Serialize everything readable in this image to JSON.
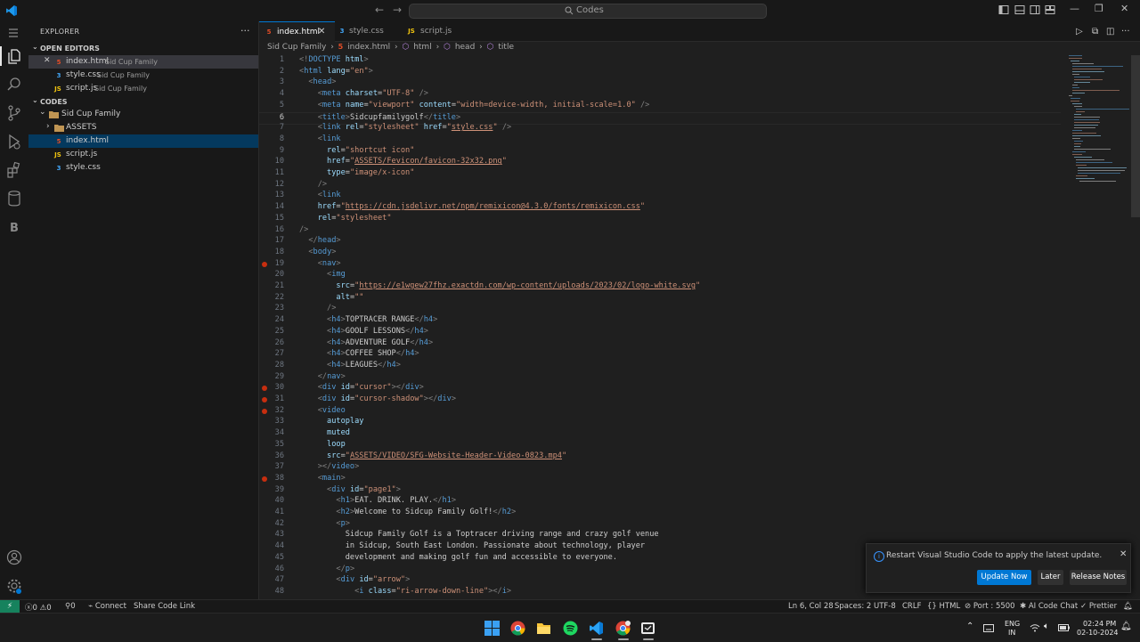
{
  "titlebar": {
    "search_text": "Codes",
    "back_icon": "arrow-left-icon",
    "forward_icon": "arrow-right-icon"
  },
  "activity_bar": {
    "items": [
      "explorer-icon",
      "search-icon",
      "source-control-icon",
      "run-debug-icon",
      "extensions-icon",
      "database-icon",
      "b-icon"
    ],
    "bottom": [
      "account-icon",
      "settings-icon"
    ]
  },
  "sidebar": {
    "title": "EXPLORER",
    "open_editors_label": "OPEN EDITORS",
    "open_editors": [
      {
        "name": "index.html",
        "desc": "Sid Cup Family",
        "type": "html",
        "close": "✕"
      },
      {
        "name": "style.css",
        "desc": "Sid Cup Family",
        "type": "css"
      },
      {
        "name": "script.js",
        "desc": "Sid Cup Family",
        "type": "js"
      }
    ],
    "folder_label": "CODES",
    "tree": {
      "root": "Sid Cup Family",
      "items": [
        {
          "name": "ASSETS",
          "type": "folder"
        },
        {
          "name": "index.html",
          "type": "html"
        },
        {
          "name": "script.js",
          "type": "js"
        },
        {
          "name": "style.css",
          "type": "css"
        }
      ]
    }
  },
  "tabs": [
    {
      "name": "index.html",
      "type": "html",
      "active": true
    },
    {
      "name": "style.css",
      "type": "css",
      "active": false
    },
    {
      "name": "script.js",
      "type": "js",
      "active": false
    }
  ],
  "breadcrumb": [
    "Sid Cup Family",
    "index.html",
    "html",
    "head",
    "title"
  ],
  "code_lines": [
    {
      "n": 1,
      "html": "<span class='t-br'>&lt;!</span><span class='t-tag'>DOCTYPE</span> <span class='t-at'>html</span><span class='t-br'>&gt;</span>"
    },
    {
      "n": 2,
      "html": "<span class='t-br'>&lt;</span><span class='t-tag'>html</span> <span class='t-at'>lang</span><span class='t-tx'>=</span><span class='t-st'>\"en\"</span><span class='t-br'>&gt;</span>"
    },
    {
      "n": 3,
      "html": "  <span class='t-br'>&lt;</span><span class='t-tag'>head</span><span class='t-br'>&gt;</span>"
    },
    {
      "n": 4,
      "html": "    <span class='t-br'>&lt;</span><span class='t-tag'>meta</span> <span class='t-at'>charset</span><span class='t-tx'>=</span><span class='t-st'>\"UTF-8\"</span> <span class='t-br'>/&gt;</span>"
    },
    {
      "n": 5,
      "html": "    <span class='t-br'>&lt;</span><span class='t-tag'>meta</span> <span class='t-at'>name</span><span class='t-tx'>=</span><span class='t-st'>\"viewport\"</span> <span class='t-at'>content</span><span class='t-tx'>=</span><span class='t-st'>\"width=device-width, initial-scale=1.0\"</span> <span class='t-br'>/&gt;</span>"
    },
    {
      "n": 6,
      "html": "    <span class='t-br'>&lt;</span><span class='t-tag'>title</span><span class='t-br'>&gt;</span><span class='t-tx'>Sidcupfamilygolf</span><span class='t-br'>&lt;/</span><span class='t-tag'>title</span><span class='t-br'>&gt;</span>",
      "current": true
    },
    {
      "n": 7,
      "html": "    <span class='t-br'>&lt;</span><span class='t-tag'>link</span> <span class='t-at'>rel</span><span class='t-tx'>=</span><span class='t-st'>\"stylesheet\"</span> <span class='t-at'>href</span><span class='t-tx'>=</span><span class='t-st'>\"</span><span class='t-url'>style.css</span><span class='t-st'>\"</span> <span class='t-br'>/&gt;</span>"
    },
    {
      "n": 8,
      "html": "    <span class='t-br'>&lt;</span><span class='t-tag'>link</span>"
    },
    {
      "n": 9,
      "html": "      <span class='t-at'>rel</span><span class='t-tx'>=</span><span class='t-st'>\"shortcut icon\"</span>"
    },
    {
      "n": 10,
      "html": "      <span class='t-at'>href</span><span class='t-tx'>=</span><span class='t-st'>\"</span><span class='t-url'>ASSETS/Fevicon/favicon-32x32.png</span><span class='t-st'>\"</span>"
    },
    {
      "n": 11,
      "html": "      <span class='t-at'>type</span><span class='t-tx'>=</span><span class='t-st'>\"image/x-icon\"</span>"
    },
    {
      "n": 12,
      "html": "    <span class='t-br'>/&gt;</span>"
    },
    {
      "n": 13,
      "html": "    <span class='t-br'>&lt;</span><span class='t-tag'>link</span>"
    },
    {
      "n": 14,
      "html": "    <span class='t-at'>href</span><span class='t-tx'>=</span><span class='t-st'>\"</span><span class='t-url'>https://cdn.jsdelivr.net/npm/remixicon@4.3.0/fonts/remixicon.css</span><span class='t-st'>\"</span>"
    },
    {
      "n": 15,
      "html": "    <span class='t-at'>rel</span><span class='t-tx'>=</span><span class='t-st'>\"stylesheet\"</span>"
    },
    {
      "n": 16,
      "html": "<span class='t-br'>/&gt;</span>"
    },
    {
      "n": 17,
      "html": "  <span class='t-br'>&lt;/</span><span class='t-tag'>head</span><span class='t-br'>&gt;</span>"
    },
    {
      "n": 18,
      "html": "  <span class='t-br'>&lt;</span><span class='t-tag'>body</span><span class='t-br'>&gt;</span>"
    },
    {
      "n": 19,
      "html": "    <span class='t-br'>&lt;</span><span class='t-tag'>nav</span><span class='t-br'>&gt;</span>",
      "bp": true
    },
    {
      "n": 20,
      "html": "      <span class='t-br'>&lt;</span><span class='t-tag'>img</span>"
    },
    {
      "n": 21,
      "html": "        <span class='t-at'>src</span><span class='t-tx'>=</span><span class='t-st'>\"</span><span class='t-url'>https://e1wgew27fhz.exactdn.com/wp-content/uploads/2023/02/logo-white.svg</span><span class='t-st'>\"</span>"
    },
    {
      "n": 22,
      "html": "        <span class='t-at'>alt</span><span class='t-tx'>=</span><span class='t-st'>\"\"</span>"
    },
    {
      "n": 23,
      "html": "      <span class='t-br'>/&gt;</span>"
    },
    {
      "n": 24,
      "html": "      <span class='t-br'>&lt;</span><span class='t-tag'>h4</span><span class='t-br'>&gt;</span><span class='t-tx'>TOPTRACER RANGE</span><span class='t-br'>&lt;/</span><span class='t-tag'>h4</span><span class='t-br'>&gt;</span>"
    },
    {
      "n": 25,
      "html": "      <span class='t-br'>&lt;</span><span class='t-tag'>h4</span><span class='t-br'>&gt;</span><span class='t-tx'>GOOLF LESSONS</span><span class='t-br'>&lt;/</span><span class='t-tag'>h4</span><span class='t-br'>&gt;</span>"
    },
    {
      "n": 26,
      "html": "      <span class='t-br'>&lt;</span><span class='t-tag'>h4</span><span class='t-br'>&gt;</span><span class='t-tx'>ADVENTURE GOLF</span><span class='t-br'>&lt;/</span><span class='t-tag'>h4</span><span class='t-br'>&gt;</span>"
    },
    {
      "n": 27,
      "html": "      <span class='t-br'>&lt;</span><span class='t-tag'>h4</span><span class='t-br'>&gt;</span><span class='t-tx'>COFFEE SHOP</span><span class='t-br'>&lt;/</span><span class='t-tag'>h4</span><span class='t-br'>&gt;</span>"
    },
    {
      "n": 28,
      "html": "      <span class='t-br'>&lt;</span><span class='t-tag'>h4</span><span class='t-br'>&gt;</span><span class='t-tx'>LEAGUES</span><span class='t-br'>&lt;/</span><span class='t-tag'>h4</span><span class='t-br'>&gt;</span>"
    },
    {
      "n": 29,
      "html": "    <span class='t-br'>&lt;/</span><span class='t-tag'>nav</span><span class='t-br'>&gt;</span>"
    },
    {
      "n": 30,
      "html": "    <span class='t-br'>&lt;</span><span class='t-tag'>div</span> <span class='t-at'>id</span><span class='t-tx'>=</span><span class='t-st'>\"cursor\"</span><span class='t-br'>&gt;&lt;/</span><span class='t-tag'>div</span><span class='t-br'>&gt;</span>",
      "bp": true
    },
    {
      "n": 31,
      "html": "    <span class='t-br'>&lt;</span><span class='t-tag'>div</span> <span class='t-at'>id</span><span class='t-tx'>=</span><span class='t-st'>\"cursor-shadow\"</span><span class='t-br'>&gt;&lt;/</span><span class='t-tag'>div</span><span class='t-br'>&gt;</span>",
      "bp": true
    },
    {
      "n": 32,
      "html": "    <span class='t-br'>&lt;</span><span class='t-tag'>video</span>",
      "bp": true
    },
    {
      "n": 33,
      "html": "      <span class='t-at'>autoplay</span>"
    },
    {
      "n": 34,
      "html": "      <span class='t-at'>muted</span>"
    },
    {
      "n": 35,
      "html": "      <span class='t-at'>loop</span>"
    },
    {
      "n": 36,
      "html": "      <span class='t-at'>src</span><span class='t-tx'>=</span><span class='t-st'>\"</span><span class='t-url'>ASSETS/VIDEO/SFG-Website-Header-Video-0823.mp4</span><span class='t-st'>\"</span>"
    },
    {
      "n": 37,
      "html": "    <span class='t-br'>&gt;&lt;/</span><span class='t-tag'>video</span><span class='t-br'>&gt;</span>"
    },
    {
      "n": 38,
      "html": "    <span class='t-br'>&lt;</span><span class='t-tag'>main</span><span class='t-br'>&gt;</span>",
      "bp": true
    },
    {
      "n": 39,
      "html": "      <span class='t-br'>&lt;</span><span class='t-tag'>div</span> <span class='t-at'>id</span><span class='t-tx'>=</span><span class='t-st'>\"page1\"</span><span class='t-br'>&gt;</span>"
    },
    {
      "n": 40,
      "html": "        <span class='t-br'>&lt;</span><span class='t-tag'>h1</span><span class='t-br'>&gt;</span><span class='t-tx'>EAT. DRINK. PLAY.</span><span class='t-br'>&lt;/</span><span class='t-tag'>h1</span><span class='t-br'>&gt;</span>"
    },
    {
      "n": 41,
      "html": "        <span class='t-br'>&lt;</span><span class='t-tag'>h2</span><span class='t-br'>&gt;</span><span class='t-tx'>Welcome to Sidcup Family Golf!</span><span class='t-br'>&lt;/</span><span class='t-tag'>h2</span><span class='t-br'>&gt;</span>"
    },
    {
      "n": 42,
      "html": "        <span class='t-br'>&lt;</span><span class='t-tag'>p</span><span class='t-br'>&gt;</span>"
    },
    {
      "n": 43,
      "html": "          <span class='t-tx'>Sidcup Family Golf is a Toptracer driving range and crazy golf venue</span>"
    },
    {
      "n": 44,
      "html": "          <span class='t-tx'>in Sidcup, South East London. Passionate about technology, player</span>"
    },
    {
      "n": 45,
      "html": "          <span class='t-tx'>development and making golf fun and accessible to everyone.</span>"
    },
    {
      "n": 46,
      "html": "        <span class='t-br'>&lt;/</span><span class='t-tag'>p</span><span class='t-br'>&gt;</span>"
    },
    {
      "n": 47,
      "html": "        <span class='t-br'>&lt;</span><span class='t-tag'>div</span> <span class='t-at'>id</span><span class='t-tx'>=</span><span class='t-st'>\"arrow\"</span><span class='t-br'>&gt;</span>"
    },
    {
      "n": 48,
      "html": "            <span class='t-br'>&lt;</span><span class='t-tag'>i</span> <span class='t-at'>class</span><span class='t-tx'>=</span><span class='t-st'>\"ri-arrow-down-line\"</span><span class='t-br'>&gt;&lt;/</span><span class='t-tag'>i</span><span class='t-br'>&gt;</span>"
    }
  ],
  "notification": {
    "message": "Restart Visual Studio Code to apply the latest update.",
    "update_now": "Update Now",
    "later": "Later",
    "release_notes": "Release Notes"
  },
  "statusbar": {
    "errors": "0",
    "warnings": "0",
    "ports": "0",
    "connect": "Connect",
    "share": "Share Code Link",
    "position": "Ln 6, Col 28",
    "spaces": "Spaces: 2",
    "encoding": "UTF-8",
    "eol": "CRLF",
    "language": "HTML",
    "port": "Port : 5500",
    "ai_chat": "AI Code Chat",
    "prettier": "Prettier"
  },
  "taskbar": {
    "apps": [
      "windows-start-icon",
      "chrome-icon",
      "file-explorer-icon",
      "spotify-icon",
      "vscode-icon",
      "chrome-profile-icon",
      "app-icon"
    ],
    "lang_top": "ENG",
    "lang_bottom": "IN",
    "time": "02:24 PM",
    "date": "02-10-2024"
  },
  "colors": {
    "accent": "#0078d4",
    "remote": "#16825d",
    "breakpoint": "#c72e0f"
  }
}
